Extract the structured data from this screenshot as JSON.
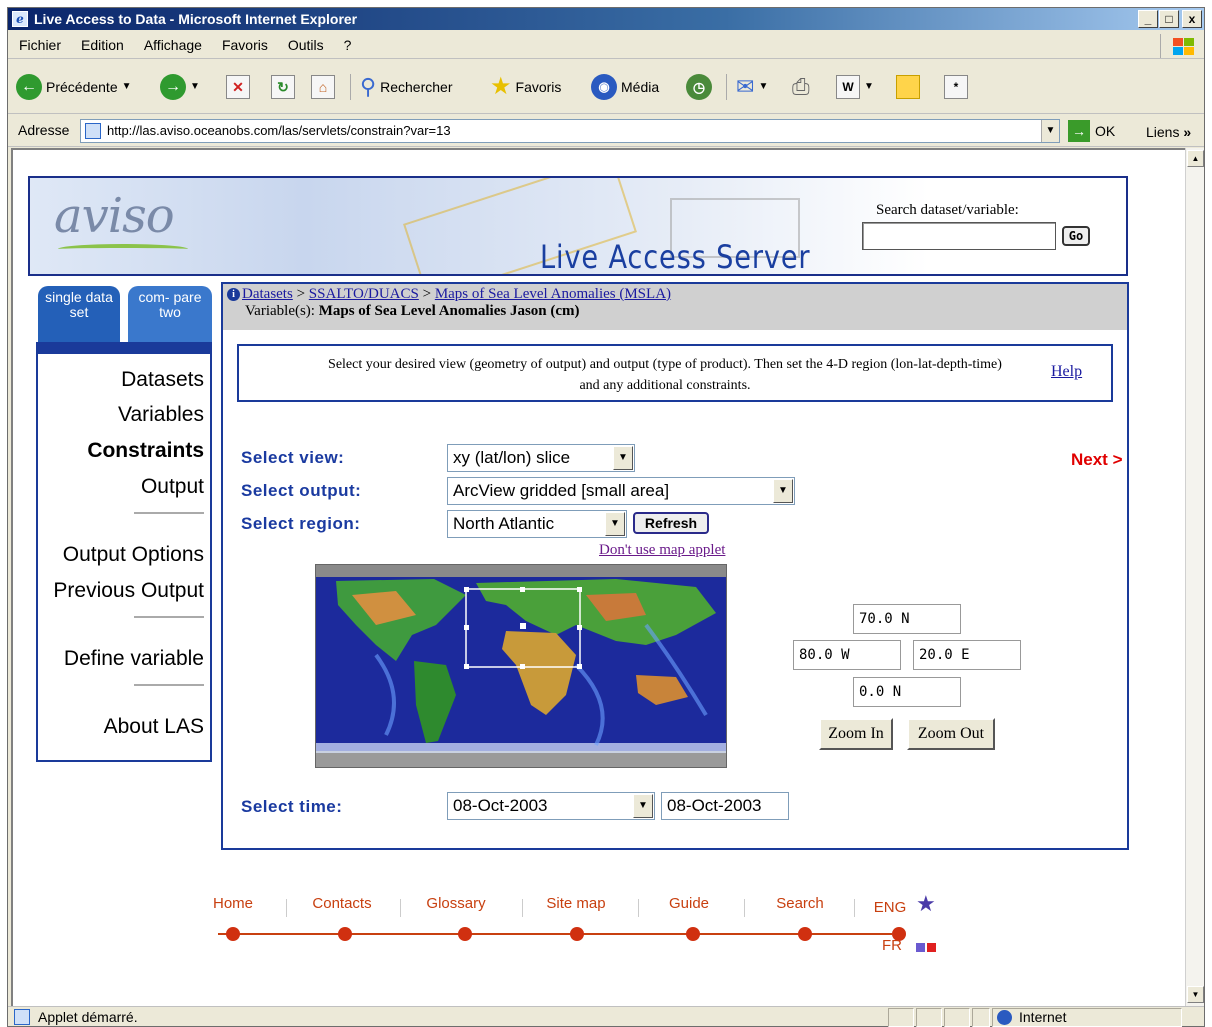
{
  "window": {
    "title": "Live Access to Data - Microsoft Internet Explorer",
    "min": "_",
    "max": "□",
    "close": "x"
  },
  "menu": [
    "Fichier",
    "Edition",
    "Affichage",
    "Favoris",
    "Outils",
    "?"
  ],
  "toolbar": {
    "back": "Précédente",
    "search": "Rechercher",
    "favorites": "Favoris",
    "media": "Média"
  },
  "address": {
    "label": "Adresse",
    "url": "http://las.aviso.oceanobs.com/las/servlets/constrain?var=13",
    "go": "OK",
    "links": "Liens"
  },
  "status": {
    "text": "Applet démarré.",
    "zone": "Internet"
  },
  "banner": {
    "logo": "aviso",
    "title": "Live Access Server",
    "search_label": "Search dataset/variable:",
    "search_value": "",
    "go": "Go"
  },
  "tabs": {
    "single": "single data set",
    "compare": "com- pare two"
  },
  "nav": {
    "datasets": "Datasets",
    "variables": "Variables",
    "constraints": "Constraints",
    "output": "Output",
    "output_options": "Output Options",
    "previous_output": "Previous Output",
    "define_variable": "Define variable",
    "about": "About LAS"
  },
  "breadcrumb": {
    "info": "i",
    "datasets": "Datasets",
    "ssalto": "SSALTO/DUACS",
    "maps": "Maps of Sea Level Anomalies (MSLA)",
    "variable_prefix": "Variable(s):",
    "variable": "Maps of Sea Level Anomalies Jason (cm)"
  },
  "instructions": {
    "text": "Select your desired view (geometry of output) and output (type of product). Then set the 4-D region (lon-lat-depth-time) and any additional constraints.",
    "help": "Help"
  },
  "form": {
    "view_label": "Select view:",
    "view_value": "xy (lat/lon) slice",
    "output_label": "Select output:",
    "output_value": "ArcView gridded [small area]",
    "region_label": "Select region:",
    "region_value": "North Atlantic",
    "refresh": "Refresh",
    "next": "Next >",
    "no_applet": "Don't use map applet",
    "time_label": "Select time:",
    "time_start": "08-Oct-2003",
    "time_end": "08-Oct-2003"
  },
  "coords": {
    "north": "70.0 N",
    "west": "80.0 W",
    "east": "20.0 E",
    "south": "0.0 N",
    "zoom_in": "Zoom In",
    "zoom_out": "Zoom Out"
  },
  "footer": {
    "home": "Home",
    "contacts": "Contacts",
    "glossary": "Glossary",
    "sitemap": "Site map",
    "guide": "Guide",
    "search": "Search",
    "eng": "ENG",
    "fr": "FR"
  }
}
